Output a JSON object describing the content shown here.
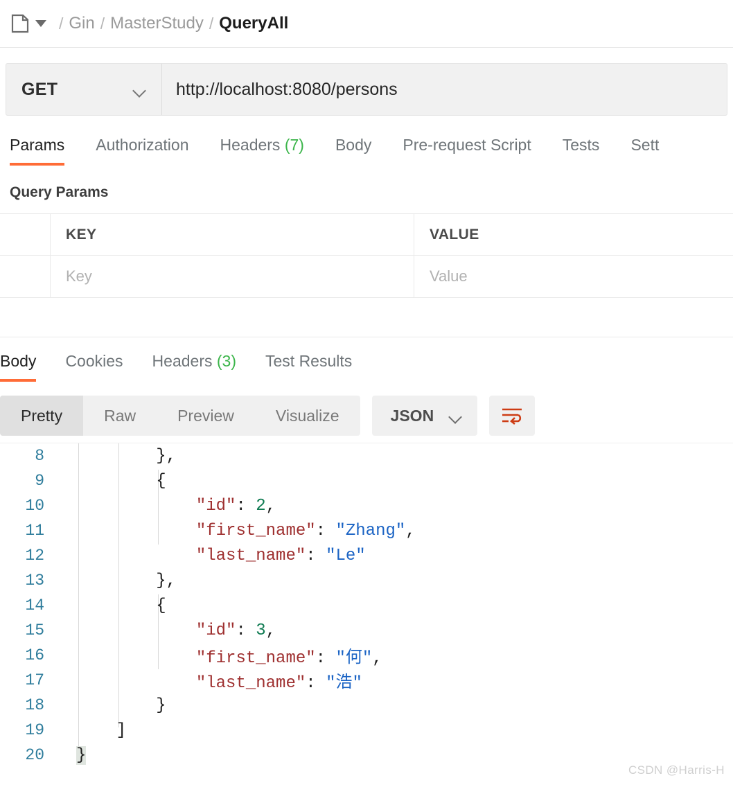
{
  "breadcrumb": {
    "folder_icon": "document-icon",
    "caret_icon": "caret-down-icon",
    "sep": "/",
    "items": [
      {
        "label": "Gin",
        "current": false
      },
      {
        "label": "MasterStudy",
        "current": false
      },
      {
        "label": "QueryAll",
        "current": true
      }
    ]
  },
  "url_bar": {
    "method": "GET",
    "method_caret": "chevron-down-icon",
    "url": "http://localhost:8080/persons"
  },
  "request_tabs": [
    {
      "label": "Params",
      "count": "",
      "active": true
    },
    {
      "label": "Authorization",
      "count": "",
      "active": false
    },
    {
      "label": "Headers",
      "count": "(7)",
      "active": false
    },
    {
      "label": "Body",
      "count": "",
      "active": false
    },
    {
      "label": "Pre-request Script",
      "count": "",
      "active": false
    },
    {
      "label": "Tests",
      "count": "",
      "active": false
    },
    {
      "label": "Sett",
      "count": "",
      "active": false
    }
  ],
  "query_params": {
    "title": "Query Params",
    "columns": {
      "key": "KEY",
      "value": "VALUE"
    },
    "rows": [
      {
        "key_placeholder": "Key",
        "value_placeholder": "Value"
      }
    ]
  },
  "response_tabs": [
    {
      "label": "Body",
      "count": "",
      "active": true
    },
    {
      "label": "Cookies",
      "count": "",
      "active": false
    },
    {
      "label": "Headers",
      "count": "(3)",
      "active": false
    },
    {
      "label": "Test Results",
      "count": "",
      "active": false
    }
  ],
  "format_toolbar": {
    "segments": [
      {
        "label": "Pretty",
        "active": true
      },
      {
        "label": "Raw",
        "active": false
      },
      {
        "label": "Preview",
        "active": false
      },
      {
        "label": "Visualize",
        "active": false
      }
    ],
    "language": "JSON",
    "language_caret": "chevron-down-icon",
    "wrap_icon": "word-wrap-icon",
    "wrap_icon_color": "#cd3c14"
  },
  "code_viewer": {
    "accent_color": "#ff6c37",
    "line_number_color": "#2f7d9c",
    "key_color": "#9e2f2f",
    "string_color": "#1a63c4",
    "number_color": "#0f7b52",
    "lines": [
      {
        "n": "8",
        "text": "        },",
        "indent": 2
      },
      {
        "n": "9",
        "text": "        {",
        "indent": 2
      },
      {
        "n": "10",
        "text": "            \"id\": 2,",
        "indent": 3
      },
      {
        "n": "11",
        "text": "            \"first_name\": \"Zhang\",",
        "indent": 3
      },
      {
        "n": "12",
        "text": "            \"last_name\": \"Le\"",
        "indent": 3
      },
      {
        "n": "13",
        "text": "        },",
        "indent": 2
      },
      {
        "n": "14",
        "text": "        {",
        "indent": 2
      },
      {
        "n": "15",
        "text": "            \"id\": 3,",
        "indent": 3
      },
      {
        "n": "16",
        "text": "            \"first_name\": \"何\",",
        "indent": 3
      },
      {
        "n": "17",
        "text": "            \"last_name\": \"浩\"",
        "indent": 3
      },
      {
        "n": "18",
        "text": "        }",
        "indent": 2
      },
      {
        "n": "19",
        "text": "    ]",
        "indent": 1
      },
      {
        "n": "20",
        "text": "}",
        "indent": 0
      }
    ]
  },
  "watermark": "CSDN @Harris-H"
}
